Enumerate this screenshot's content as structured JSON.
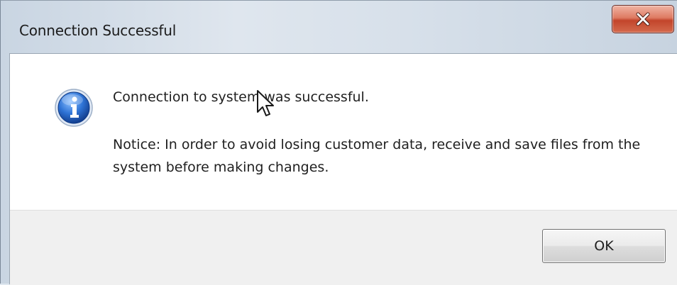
{
  "window": {
    "title": "Connection Successful"
  },
  "dialog": {
    "icon": "info-icon",
    "message_primary": "Connection to system was successful.",
    "message_notice": "Notice: In order to avoid losing customer data, receive and save files from the system before making changes."
  },
  "buttons": {
    "close_icon": "close-icon",
    "ok_label": "OK"
  },
  "colors": {
    "close_button": "#c9553a",
    "info_icon_blue": "#1e5fc0",
    "footer_background": "#f0f0f0"
  }
}
